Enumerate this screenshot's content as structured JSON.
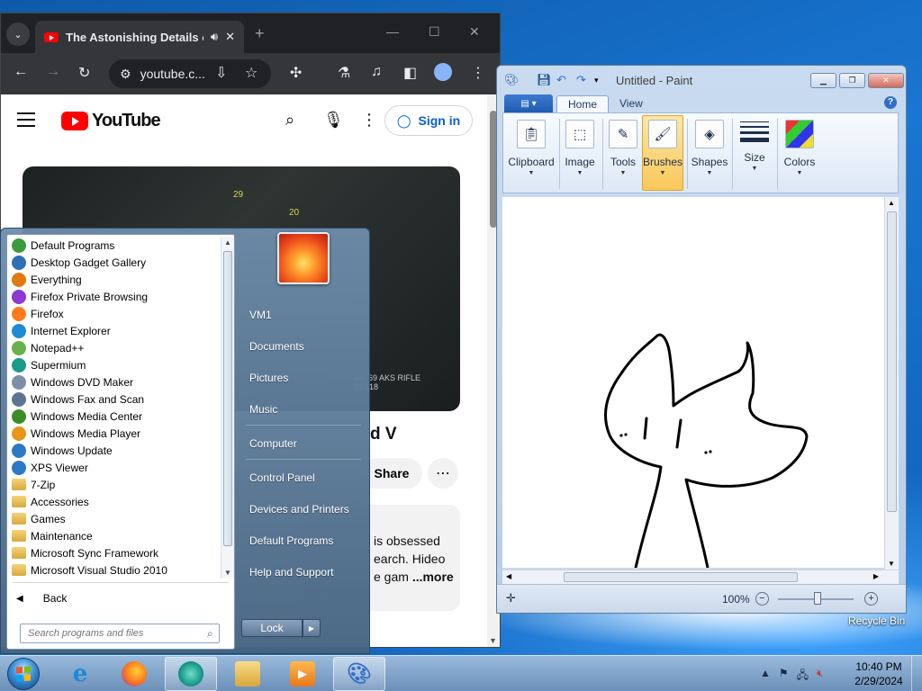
{
  "chrome": {
    "tab_title": "The Astonishing Details of",
    "new_tab": "+",
    "omnibox_text": "youtube.c...",
    "youtube": {
      "logo_text": "YouTube",
      "sign_in": "Sign in",
      "title_fragment": "d V",
      "share": "Share",
      "desc_line1": "is obsessed",
      "desc_line2": "earch. Hideo",
      "desc_line3": "e gam",
      "desc_more": "...more",
      "hud_marker_1": "29",
      "hud_marker_2": "20",
      "hud_rifle": "AM-69 AKS RIFLE",
      "hud_ammo": "31/218"
    }
  },
  "paint": {
    "title": "Untitled - Paint",
    "tabs": [
      "Home",
      "View"
    ],
    "ribbon": [
      "Clipboard",
      "Image",
      "Tools",
      "Brushes",
      "Shapes",
      "Size",
      "Colors"
    ],
    "active_tool": "Brushes",
    "zoom": "100%"
  },
  "start_menu": {
    "programs": [
      {
        "label": "Default Programs",
        "icon": "default-programs-icon",
        "color": "#3c9a3c"
      },
      {
        "label": "Desktop Gadget Gallery",
        "icon": "gadget-icon",
        "color": "#2e6fb8"
      },
      {
        "label": "Everything",
        "icon": "everything-icon",
        "color": "#e07a10"
      },
      {
        "label": "Firefox Private Browsing",
        "icon": "firefox-private-icon",
        "color": "#8c3ad1"
      },
      {
        "label": "Firefox",
        "icon": "firefox-icon",
        "color": "#ff7a1a"
      },
      {
        "label": "Internet Explorer",
        "icon": "ie-icon",
        "color": "#1e8ad6"
      },
      {
        "label": "Notepad++",
        "icon": "notepadpp-icon",
        "color": "#6bb04a"
      },
      {
        "label": "Supermium",
        "icon": "supermium-icon",
        "color": "#1a9b8a"
      },
      {
        "label": "Windows DVD Maker",
        "icon": "dvd-maker-icon",
        "color": "#7d8fa8"
      },
      {
        "label": "Windows Fax and Scan",
        "icon": "fax-icon",
        "color": "#5d7590"
      },
      {
        "label": "Windows Media Center",
        "icon": "media-center-icon",
        "color": "#3d8a2a"
      },
      {
        "label": "Windows Media Player",
        "icon": "media-player-icon",
        "color": "#e8951a"
      },
      {
        "label": "Windows Update",
        "icon": "windows-update-icon",
        "color": "#2e78c8"
      },
      {
        "label": "XPS Viewer",
        "icon": "xps-icon",
        "color": "#2e78c8"
      },
      {
        "label": "7-Zip",
        "icon": "folder-icon",
        "color": "folder"
      },
      {
        "label": "Accessories",
        "icon": "folder-icon",
        "color": "folder"
      },
      {
        "label": "Games",
        "icon": "folder-icon",
        "color": "folder"
      },
      {
        "label": "Maintenance",
        "icon": "folder-icon",
        "color": "folder"
      },
      {
        "label": "Microsoft Sync Framework",
        "icon": "folder-icon",
        "color": "folder"
      },
      {
        "label": "Microsoft Visual Studio 2010",
        "icon": "folder-icon",
        "color": "folder"
      }
    ],
    "back": "Back",
    "search_placeholder": "Search programs and files",
    "right_items": [
      "VM1",
      "Documents",
      "Pictures",
      "Music",
      "Computer",
      "Control Panel",
      "Devices and Printers",
      "Default Programs",
      "Help and Support"
    ],
    "lock": "Lock"
  },
  "desktop": {
    "recycle_bin": "Recycle Bin"
  },
  "taskbar": {
    "time": "10:40 PM",
    "date": "2/29/2024"
  }
}
